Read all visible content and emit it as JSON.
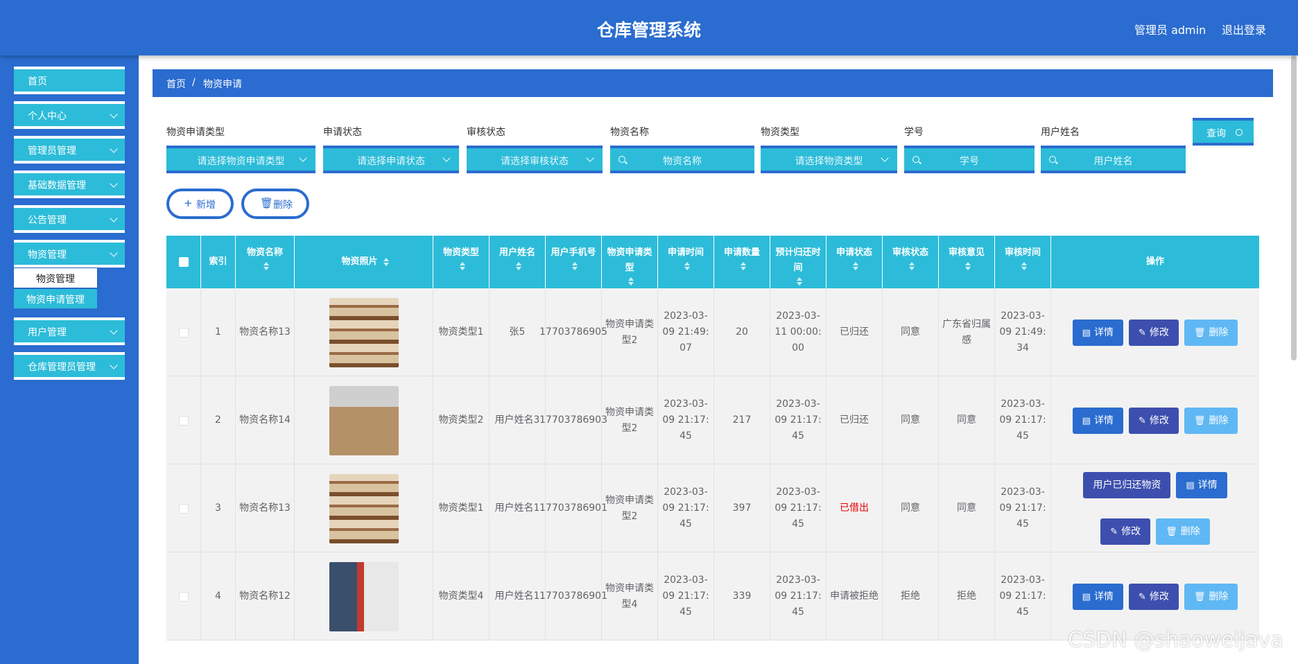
{
  "header": {
    "title": "仓库管理系统",
    "admin_label": "管理员 admin",
    "logout": "退出登录"
  },
  "sidebar": {
    "items": [
      {
        "label": "首页"
      },
      {
        "label": "个人中心"
      },
      {
        "label": "管理员管理"
      },
      {
        "label": "基础数据管理"
      },
      {
        "label": "公告管理"
      },
      {
        "label": "物资管理"
      },
      {
        "label": "用户管理"
      },
      {
        "label": "仓库管理员管理"
      }
    ],
    "submenu": [
      {
        "label": "物资管理"
      },
      {
        "label": "物资申请管理"
      }
    ]
  },
  "breadcrumb": {
    "home": "首页",
    "sep": "/",
    "current": "物资申请"
  },
  "filters": [
    {
      "label": "物资申请类型",
      "placeholder": "请选择物资申请类型"
    },
    {
      "label": "申请状态",
      "placeholder": "请选择申请状态"
    },
    {
      "label": "审核状态",
      "placeholder": "请选择审核状态"
    },
    {
      "label": "物资名称",
      "placeholder": "物资名称"
    },
    {
      "label": "物资类型",
      "placeholder": "请选择物资类型"
    },
    {
      "label": "学号",
      "placeholder": "学号"
    },
    {
      "label": "用户姓名",
      "placeholder": "用户姓名"
    }
  ],
  "actions": {
    "query": "查询",
    "add": "新增",
    "delete": "删除"
  },
  "table": {
    "headers": [
      "索引",
      "物资名称",
      "物资照片",
      "物资类型",
      "用户姓名",
      "用户手机号",
      "物资申请类型",
      "申请时间",
      "申请数量",
      "预计归还时间",
      "申请状态",
      "审核状态",
      "审核意见",
      "审核时间",
      "操作"
    ],
    "buttons": {
      "detail": "详情",
      "edit": "修改",
      "delete": "删除",
      "return": "用户已归还物资"
    },
    "rows": [
      {
        "index": "1",
        "name": "物资名称13",
        "type": "物资类型1",
        "user": "张5",
        "phone": "17703786905",
        "apply_type": "物资申请类型2",
        "apply_time": "2023-03-09 21:49:07",
        "qty": "20",
        "return_time": "2023-03-11 00:00:00",
        "apply_status": "已归还",
        "audit_status": "同意",
        "audit_opinion": "广东省归属感",
        "audit_time": "2023-03-09 21:49:34"
      },
      {
        "index": "2",
        "name": "物资名称14",
        "type": "物资类型2",
        "user": "用户姓名3",
        "phone": "17703786903",
        "apply_type": "物资申请类型2",
        "apply_time": "2023-03-09 21:17:45",
        "qty": "217",
        "return_time": "2023-03-09 21:17:45",
        "apply_status": "已归还",
        "audit_status": "同意",
        "audit_opinion": "同意",
        "audit_time": "2023-03-09 21:17:45"
      },
      {
        "index": "3",
        "name": "物资名称13",
        "type": "物资类型1",
        "user": "用户姓名1",
        "phone": "17703786901",
        "apply_type": "物资申请类型2",
        "apply_time": "2023-03-09 21:17:45",
        "qty": "397",
        "return_time": "2023-03-09 21:17:45",
        "apply_status": "已借出",
        "audit_status": "同意",
        "audit_opinion": "同意",
        "audit_time": "2023-03-09 21:17:45"
      },
      {
        "index": "4",
        "name": "物资名称12",
        "type": "物资类型4",
        "user": "用户姓名1",
        "phone": "17703786901",
        "apply_type": "物资申请类型4",
        "apply_time": "2023-03-09 21:17:45",
        "qty": "339",
        "return_time": "2023-03-09 21:17:45",
        "apply_status": "申请被拒绝",
        "audit_status": "拒绝",
        "audit_opinion": "拒绝",
        "audit_time": "2023-03-09 21:17:45"
      }
    ]
  },
  "watermark": "CSDN @shaoweijava",
  "colors": {
    "primary": "#2a6ccf",
    "accent": "#2cbcd9",
    "edit": "#3d4fae",
    "danger_light": "#5fb8f4",
    "status_red": "#e60000"
  }
}
